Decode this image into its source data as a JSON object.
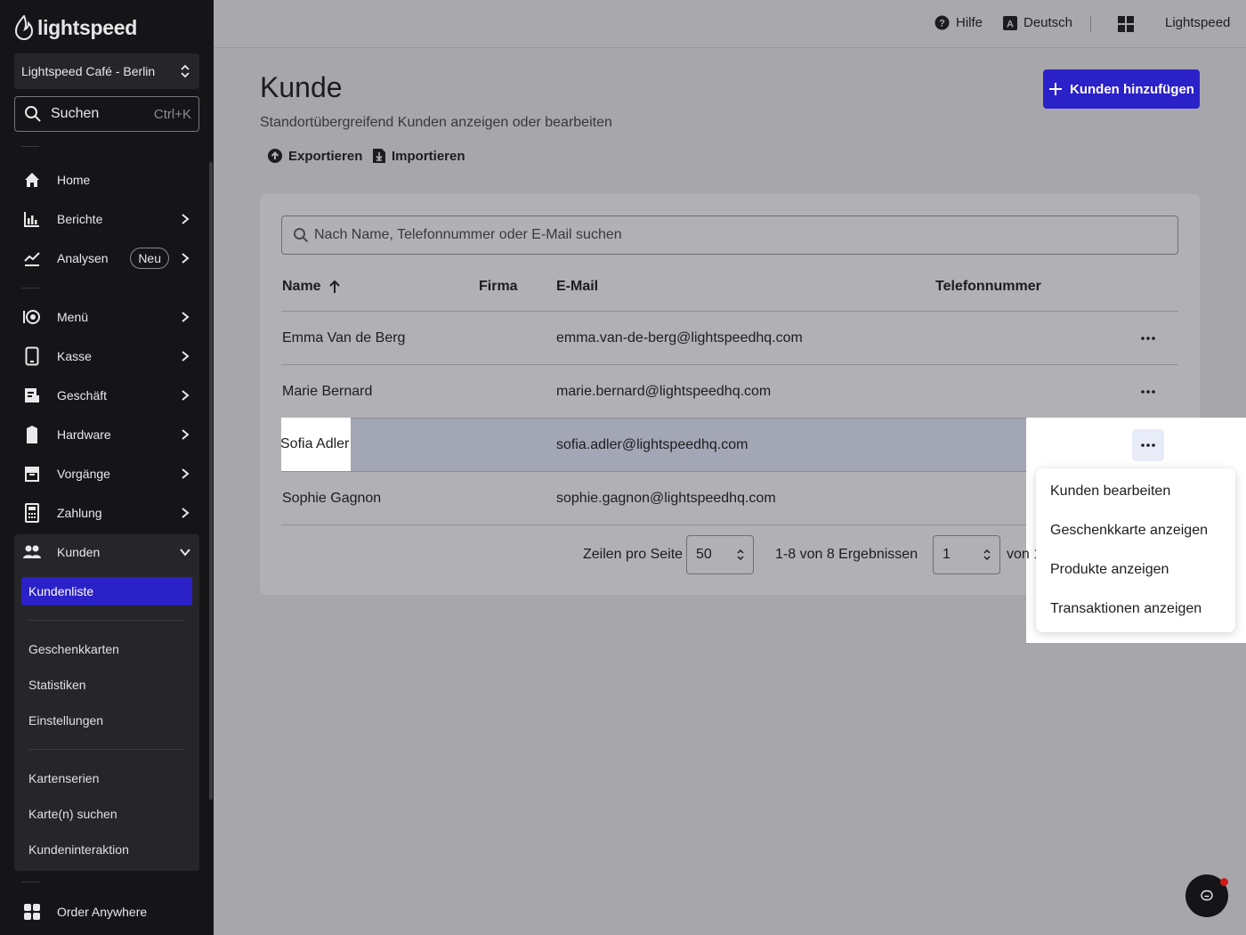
{
  "brand": {
    "name": "lightspeed"
  },
  "sidebar": {
    "location": "Lightspeed Café - Berlin",
    "search": {
      "label": "Suchen",
      "shortcut": "Ctrl+K"
    },
    "items": [
      {
        "label": "Home",
        "icon": "home-icon"
      },
      {
        "label": "Berichte",
        "icon": "bar-chart-icon"
      },
      {
        "label": "Analysen",
        "icon": "trend-icon",
        "badge": "Neu"
      },
      {
        "label": "Menü",
        "icon": "menu-icon"
      },
      {
        "label": "Kasse",
        "icon": "tablet-icon"
      },
      {
        "label": "Geschäft",
        "icon": "store-icon"
      },
      {
        "label": "Hardware",
        "icon": "hardware-icon"
      },
      {
        "label": "Vorgänge",
        "icon": "archive-icon"
      },
      {
        "label": "Zahlung",
        "icon": "calculator-icon"
      },
      {
        "label": "Kunden",
        "icon": "people-icon"
      }
    ],
    "customers_sub": {
      "active": "Kundenliste",
      "group1": [
        "Geschenkkarten",
        "Statistiken",
        "Einstellungen"
      ],
      "group2": [
        "Kartenserien",
        "Karte(n) suchen",
        "Kundeninteraktion"
      ]
    },
    "bottom_item": {
      "label": "Order Anywhere",
      "icon": "order-anywhere-icon"
    }
  },
  "topbar": {
    "help": "Hilfe",
    "language": "Deutsch",
    "account": "Lightspeed"
  },
  "page": {
    "title": "Kunde",
    "subtitle": "Standortübergreifend Kunden anzeigen oder bearbeiten",
    "export": "Exportieren",
    "import": "Importieren",
    "add_button": "Kunden hinzufügen"
  },
  "table": {
    "search_placeholder": "Nach Name, Telefonnummer oder E-Mail suchen",
    "columns": {
      "name": "Name",
      "company": "Firma",
      "email": "E-Mail",
      "phone": "Telefonnummer"
    },
    "rows": [
      {
        "name": "Emma Van de Berg",
        "company": "",
        "email": "emma.van-de-berg@lightspeedhq.com",
        "phone": ""
      },
      {
        "name": "Marie Bernard",
        "company": "",
        "email": "marie.bernard@lightspeedhq.com",
        "phone": ""
      },
      {
        "name": "Sofia Adler",
        "company": "",
        "email": "sofia.adler@lightspeedhq.com",
        "phone": ""
      },
      {
        "name": "Sophie Gagnon",
        "company": "",
        "email": "sophie.gagnon@lightspeedhq.com",
        "phone": ""
      }
    ]
  },
  "row_menu": [
    "Kunden bearbeiten",
    "Geschenkkarte anzeigen",
    "Produkte anzeigen",
    "Transaktionen anzeigen"
  ],
  "pagination": {
    "rows_per_page_label": "Zeilen pro Seite",
    "rows_per_page": "50",
    "range": "1-8 von 8 Ergebnissen",
    "page": "1",
    "of_label": "von 1"
  },
  "colors": {
    "accent": "#2a21c9",
    "sidebar_bg": "#151518",
    "overlay": "#a7a6ab"
  }
}
